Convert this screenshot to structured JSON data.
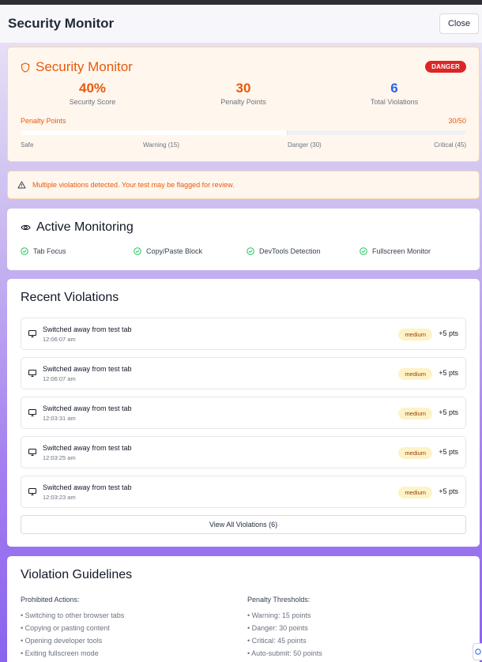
{
  "header": {
    "title": "Security Monitor",
    "close_label": "Close"
  },
  "score": {
    "title": "Security Monitor",
    "status_badge": "DANGER",
    "security_score": "40%",
    "security_score_label": "Security Score",
    "penalty_points": "30",
    "penalty_points_label": "Penalty Points",
    "total_violations": "6",
    "total_violations_label": "Total Violations",
    "progress_label": "Penalty Points",
    "progress_value": "30/50",
    "progress_fraction": 0.6,
    "thresholds": [
      "Safe",
      "Warning (15)",
      "Danger (30)",
      "Critical (45)"
    ]
  },
  "alert": {
    "icon": "warning-triangle-icon",
    "text": "Multiple violations detected. Your test may be flagged for review."
  },
  "monitoring": {
    "title": "Active Monitoring",
    "icon": "eye-icon",
    "items": [
      {
        "label": "Tab Focus"
      },
      {
        "label": "Copy/Paste Block"
      },
      {
        "label": "DevTools Detection"
      },
      {
        "label": "Fullscreen Monitor"
      }
    ]
  },
  "violations": {
    "title": "Recent Violations",
    "items": [
      {
        "description": "Switched away from test tab",
        "time": "12:06:07 am",
        "severity": "medium",
        "points": "+5 pts"
      },
      {
        "description": "Switched away from test tab",
        "time": "12:06:07 am",
        "severity": "medium",
        "points": "+5 pts"
      },
      {
        "description": "Switched away from test tab",
        "time": "12:03:31 am",
        "severity": "medium",
        "points": "+5 pts"
      },
      {
        "description": "Switched away from test tab",
        "time": "12:03:25 am",
        "severity": "medium",
        "points": "+5 pts"
      },
      {
        "description": "Switched away from test tab",
        "time": "12:03:23 am",
        "severity": "medium",
        "points": "+5 pts"
      }
    ],
    "view_all_label": "View All Violations (6)"
  },
  "guidelines": {
    "title": "Violation Guidelines",
    "prohibited_title": "Prohibited Actions:",
    "prohibited": [
      "• Switching to other browser tabs",
      "• Copying or pasting content",
      "• Opening developer tools",
      "• Exiting fullscreen mode"
    ],
    "thresholds_title": "Penalty Thresholds:",
    "thresholds": [
      "• Warning: 15 points",
      "• Danger: 30 points",
      "• Critical: 45 points",
      "• Auto-submit: 50 points"
    ]
  },
  "colors": {
    "accent": "#ea580c",
    "danger": "#dc2626",
    "success": "#22c55e",
    "blue": "#2563eb"
  }
}
